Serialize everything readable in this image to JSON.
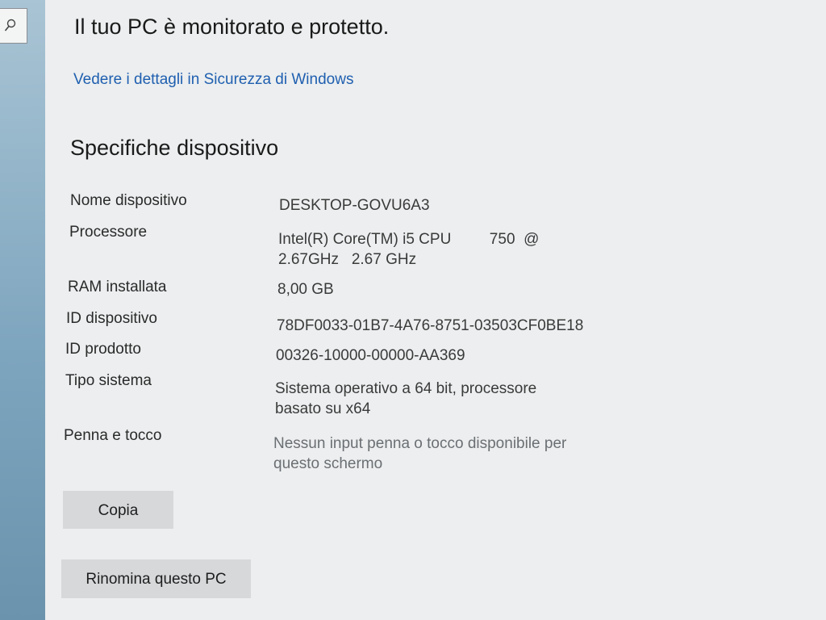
{
  "security": {
    "status_title": "Il tuo PC è monitorato e protetto.",
    "details_link": "Vedere i dettagli in Sicurezza di Windows"
  },
  "specs": {
    "title": "Specifiche dispositivo",
    "rows": [
      {
        "label": "Nome dispositivo",
        "value": "DESKTOP-GOVU6A3"
      },
      {
        "label": "Processore",
        "value": "Intel(R) Core(TM) i5 CPU         750  @\n2.67GHz   2.67 GHz"
      },
      {
        "label": "RAM installata",
        "value": "8,00 GB"
      },
      {
        "label": "ID dispositivo",
        "value": "78DF0033-01B7-4A76-8751-03503CF0BE18"
      },
      {
        "label": "ID prodotto",
        "value": "00326-10000-00000-AA369"
      },
      {
        "label": "Tipo sistema",
        "value": "Sistema operativo a 64 bit, processore\nbasato su x64"
      },
      {
        "label": "Penna e tocco",
        "value": "Nessun input penna o tocco disponibile per\nquesto schermo"
      }
    ]
  },
  "actions": {
    "copy_label": "Copia",
    "rename_label": "Rinomina questo PC"
  },
  "icons": {
    "search": "search-icon"
  }
}
